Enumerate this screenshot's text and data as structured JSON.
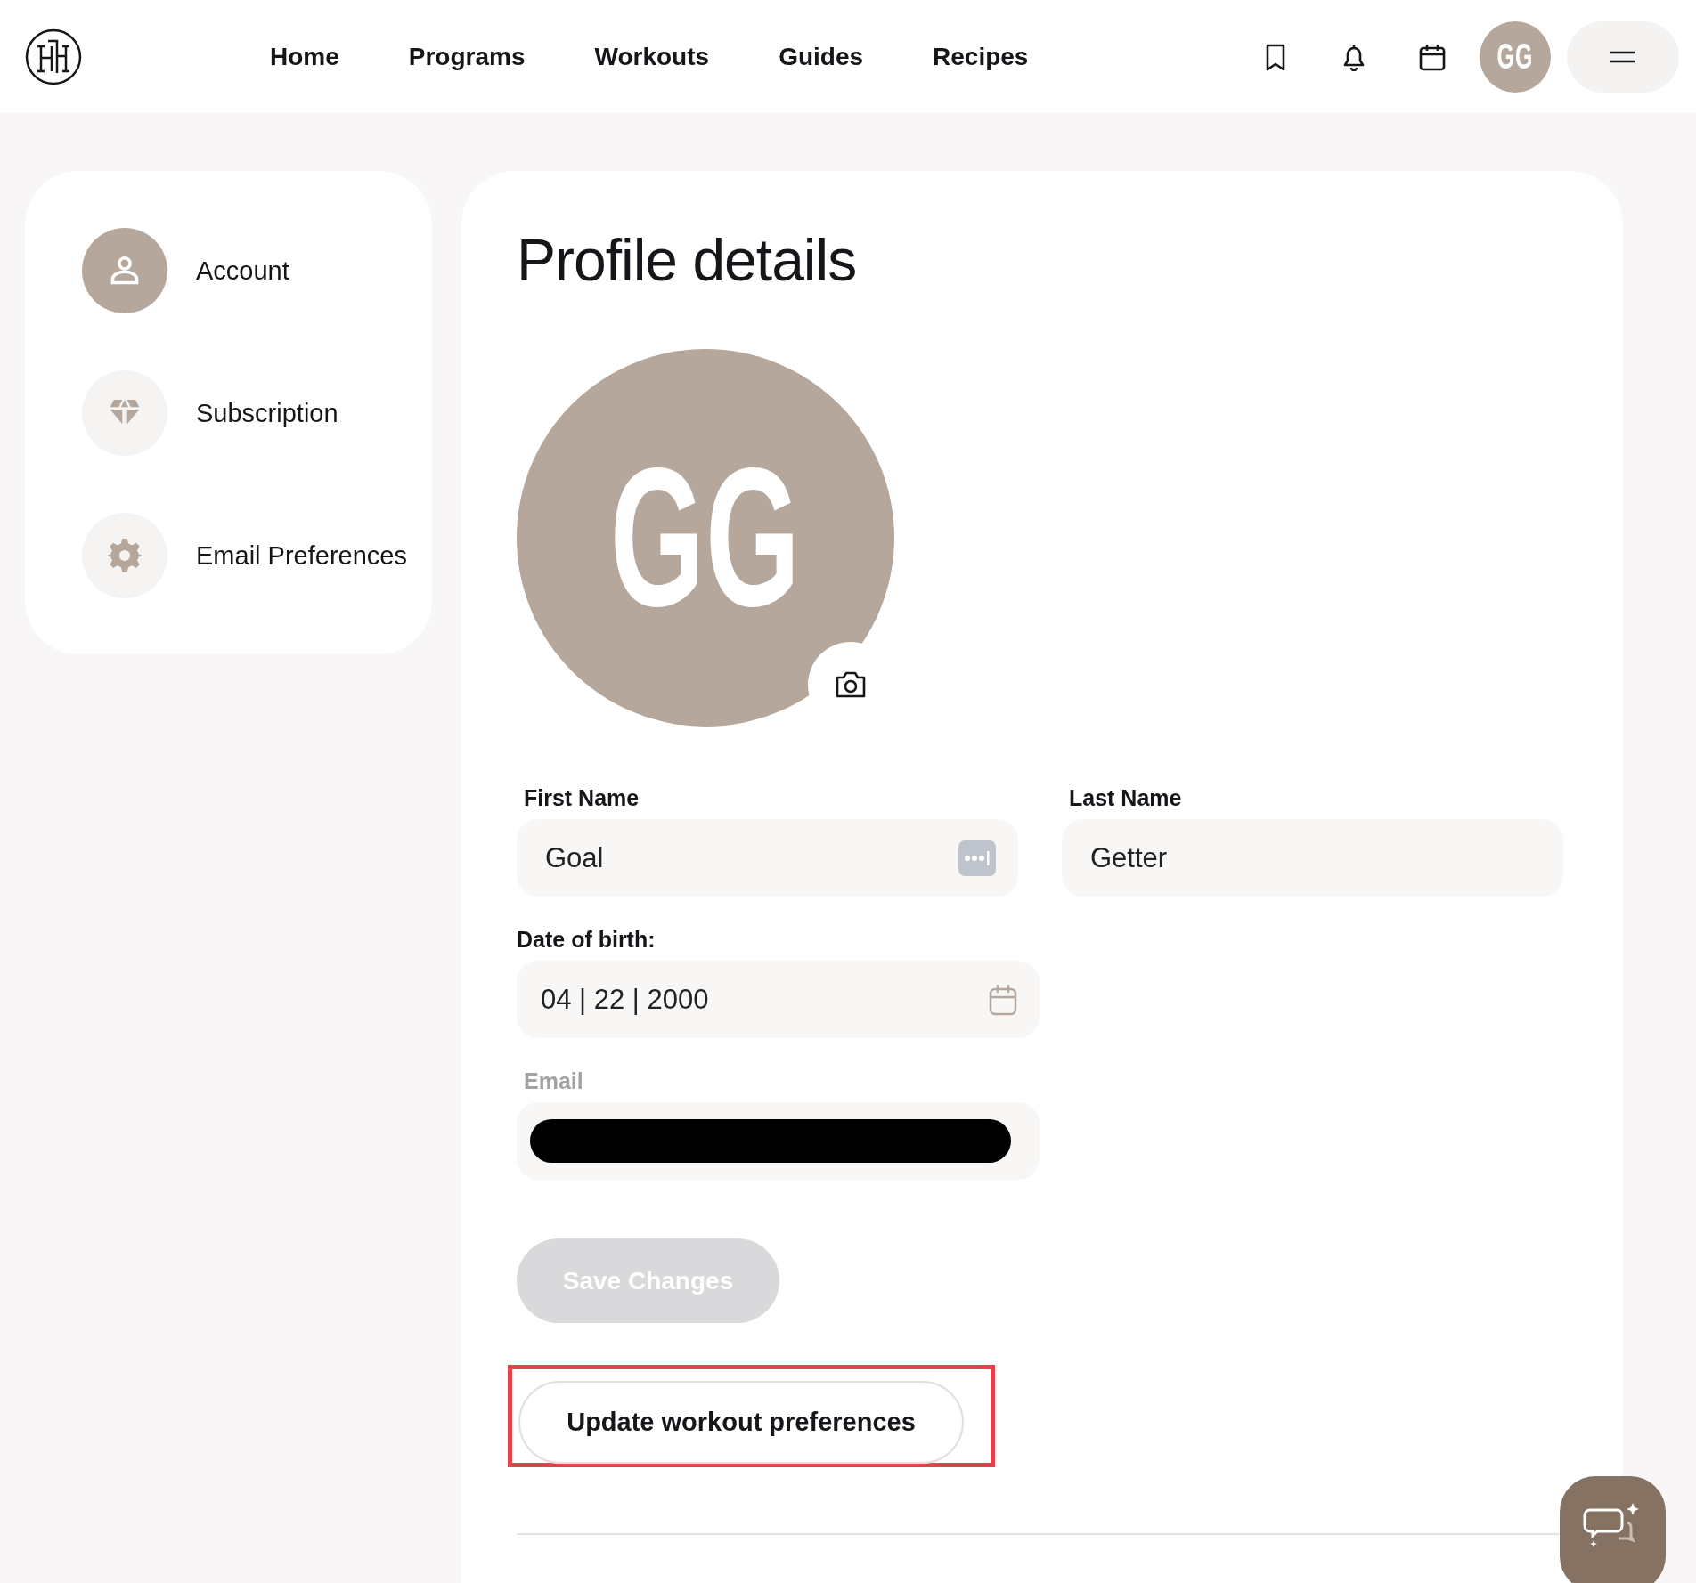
{
  "nav": {
    "links": [
      "Home",
      "Programs",
      "Workouts",
      "Guides",
      "Recipes"
    ],
    "avatar_initials": "GG"
  },
  "sidebar": {
    "items": [
      {
        "label": "Account",
        "selected": true
      },
      {
        "label": "Subscription",
        "selected": false
      },
      {
        "label": "Email Preferences",
        "selected": false
      }
    ]
  },
  "profile": {
    "title": "Profile details",
    "avatar_initials": "GG",
    "fields": [
      {
        "kind": "text",
        "label": "First Name",
        "value": "Goal",
        "autofill": true,
        "disabled": false,
        "redacted": false
      },
      {
        "kind": "text",
        "label": "Last Name",
        "value": "Getter",
        "autofill": false,
        "disabled": false,
        "redacted": false
      },
      {
        "kind": "date",
        "label": "Date of birth:",
        "value": "04 | 22 | 2000",
        "autofill": false,
        "disabled": false,
        "redacted": false
      },
      {
        "kind": "email",
        "label": "Email",
        "autofill": false,
        "disabled": true,
        "redacted": true
      }
    ],
    "save_button": {
      "label": "Save Changes",
      "disabled": true
    },
    "preferences_button": {
      "label": "Update workout preferences",
      "highlighted": true
    }
  }
}
